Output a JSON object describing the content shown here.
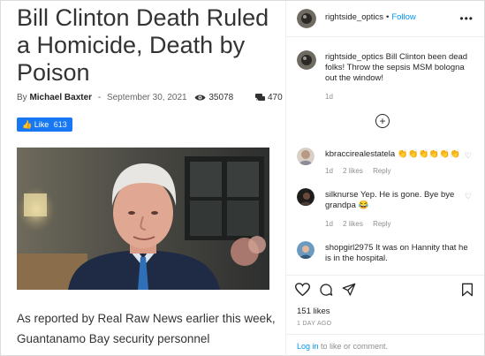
{
  "article": {
    "headline": "Bill Clinton Death Ruled a Homicide, Death by Poison",
    "by_prefix": "By",
    "author": "Michael Baxter",
    "separator": "-",
    "date": "September 30, 2021",
    "views": "35078",
    "comments": "470",
    "like_label": "Like",
    "like_count": "613",
    "body": "As reported by Real Raw News earlier this week, Guantanamo Bay security personnel"
  },
  "instagram": {
    "username": "rightside_optics",
    "dot": "•",
    "follow_label": "Follow",
    "more_label": "•••",
    "caption": {
      "user": "rightside_optics",
      "text": "Bill Clinton been dead folks! Throw the sepsis MSM bologna out the window!",
      "time": "1d"
    },
    "load_more": "+",
    "comments": [
      {
        "user": "kbraccirealestatela",
        "text": "👏👏👏👏👏👏",
        "time": "1d",
        "likes": "2 likes",
        "reply": "Reply"
      },
      {
        "user": "silknurse",
        "text": "Yep. He is gone. Bye bye grandpa 😂",
        "time": "1d",
        "likes": "2 likes",
        "reply": "Reply"
      },
      {
        "user": "shopgirl2975",
        "text": "It was on Hannity that he is in the hospital.",
        "time": "",
        "likes": "",
        "reply": ""
      }
    ],
    "likes_text": "151 likes",
    "time_ago": "1 DAY AGO",
    "login_link": "Log in",
    "login_rest": " to like or comment."
  },
  "icons": [
    "eye-icon",
    "comment-icon",
    "heart-icon",
    "comment-bubble-icon",
    "share-icon",
    "bookmark-icon",
    "more-icon"
  ],
  "colors": {
    "follow_blue": "#0095f6",
    "fb_blue": "#1877f2",
    "meta_gray": "#8e8e8e"
  }
}
